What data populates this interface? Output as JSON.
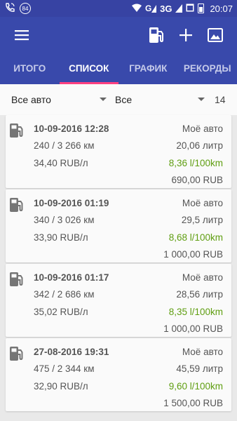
{
  "status_bar": {
    "notification_count": "84",
    "network": "3G",
    "time": "20:07"
  },
  "toolbar": {
    "menu_icon": "hamburger-menu-icon",
    "actions": [
      "fuel-pump-icon",
      "plus-icon",
      "image-icon"
    ]
  },
  "tabs": [
    {
      "label": "ИТОГО",
      "active": false
    },
    {
      "label": "СПИСОК",
      "active": true
    },
    {
      "label": "ГРАФИК",
      "active": false
    },
    {
      "label": "РЕКОРДЫ",
      "active": false
    }
  ],
  "filters": {
    "vehicle": "Все авто",
    "type": "Все",
    "count": "14"
  },
  "entries": [
    {
      "date": "10-09-2016 12:28",
      "distance": "240 / 3 266 км",
      "price": "34,40 RUB/л",
      "car": "Моё авто",
      "volume": "20,06 литр",
      "consumption": "8,36 l/100km",
      "total": "690,00 RUB"
    },
    {
      "date": "10-09-2016 01:19",
      "distance": "340 / 3 026 км",
      "price": "33,90 RUB/л",
      "car": "Моё авто",
      "volume": "29,5 литр",
      "consumption": "8,68 l/100km",
      "total": "1 000,00 RUB"
    },
    {
      "date": "10-09-2016 01:17",
      "distance": "342 / 2 686 км",
      "price": "35,02 RUB/л",
      "car": "Моё авто",
      "volume": "28,56 литр",
      "consumption": "8,35 l/100km",
      "total": "1 000,00 RUB"
    },
    {
      "date": "27-08-2016 19:31",
      "distance": "475 / 2 344 км",
      "price": "32,90 RUB/л",
      "car": "Моё авто",
      "volume": "45,59 литр",
      "consumption": "9,60 l/100km",
      "total": "1 500,00 RUB"
    }
  ],
  "colors": {
    "primary": "#3949ab",
    "status_bar": "#3743a3",
    "accent": "#ff4081",
    "consumption_text": "#5f9e11"
  }
}
